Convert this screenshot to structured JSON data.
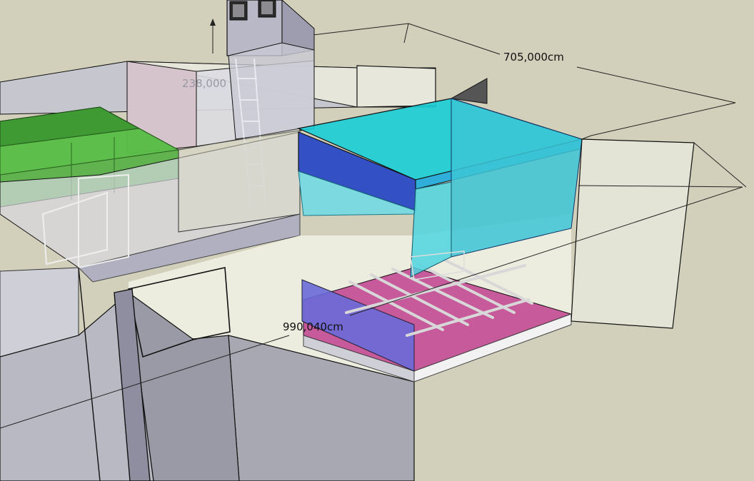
{
  "dimensions": {
    "width_label": "705,000cm",
    "length_label": "990,040cm",
    "height_label": "238,000"
  },
  "colors": {
    "background": "#d2cfba",
    "wall_glass": "#e6e6dc",
    "booth_cyan": "#2fd6df",
    "booth_blue": "#3558c8",
    "floor_pink": "#c85a9c",
    "plenum_green": "#4cae3c",
    "pit_grey": "#a8a8b0"
  },
  "objects": {
    "model": "spray-booth-3d-model",
    "exhaust_duct": "exhaust-duct",
    "ladder": "ladder",
    "cyan_canopy": "air-supply-canopy",
    "floor_grid": "floor-grating"
  }
}
